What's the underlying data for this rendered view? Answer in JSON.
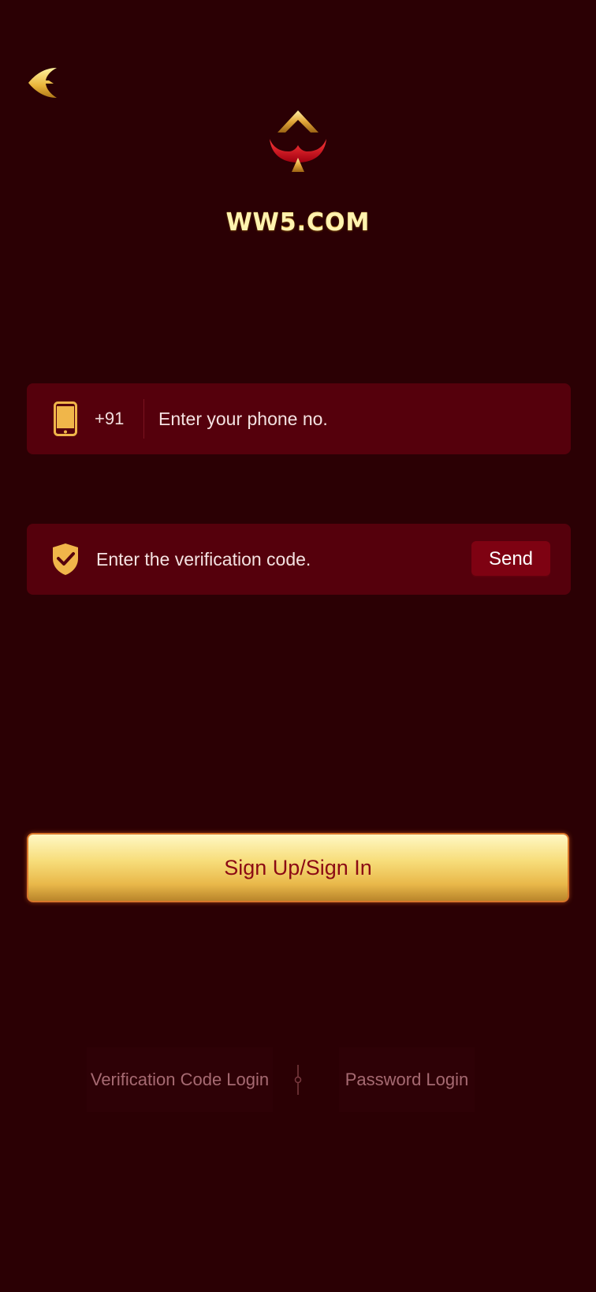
{
  "header": {
    "back_icon": "back-arrow-icon",
    "logo_icon": "spade-logo-icon",
    "brand_name": "WW5.COM"
  },
  "phone_field": {
    "icon": "phone-icon",
    "country_code": "+91",
    "placeholder": "Enter your phone no.",
    "value": ""
  },
  "code_field": {
    "icon": "shield-check-icon",
    "placeholder": "Enter the verification code.",
    "value": "",
    "send_label": "Send"
  },
  "submit": {
    "label": "Sign Up/Sign In"
  },
  "alt_login": {
    "code_login_label": "Verification Code Login",
    "password_login_label": "Password Login"
  },
  "colors": {
    "background": "#2b0004",
    "field_bg": "#55000c",
    "gold": "#e7b433",
    "send_bg": "#7e0212",
    "submit_text": "#8b0a14"
  }
}
